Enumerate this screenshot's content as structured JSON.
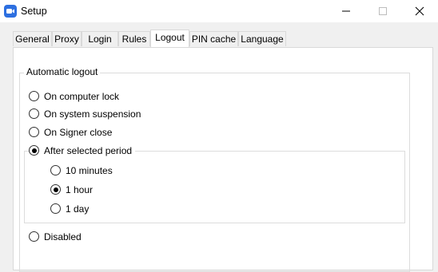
{
  "window": {
    "title": "Setup",
    "icon": "app-icon",
    "controls": [
      "minimize",
      "maximize",
      "close"
    ]
  },
  "tabs": [
    {
      "label": "General",
      "active": false
    },
    {
      "label": "Proxy",
      "active": false
    },
    {
      "label": "Login",
      "active": false
    },
    {
      "label": "Rules",
      "active": false
    },
    {
      "label": "Logout",
      "active": true
    },
    {
      "label": "PIN cache",
      "active": false
    },
    {
      "label": "Language",
      "active": false
    }
  ],
  "logout": {
    "group_label": "Automatic logout",
    "options": [
      {
        "label": "On computer lock",
        "checked": false
      },
      {
        "label": "On system suspension",
        "checked": false
      },
      {
        "label": "On Signer close",
        "checked": false
      },
      {
        "label": "After selected period",
        "checked": true
      },
      {
        "label": "Disabled",
        "checked": false
      }
    ],
    "periods": [
      {
        "label": "10 minutes",
        "checked": false
      },
      {
        "label": "1 hour",
        "checked": true
      },
      {
        "label": "1 day",
        "checked": false
      }
    ]
  }
}
